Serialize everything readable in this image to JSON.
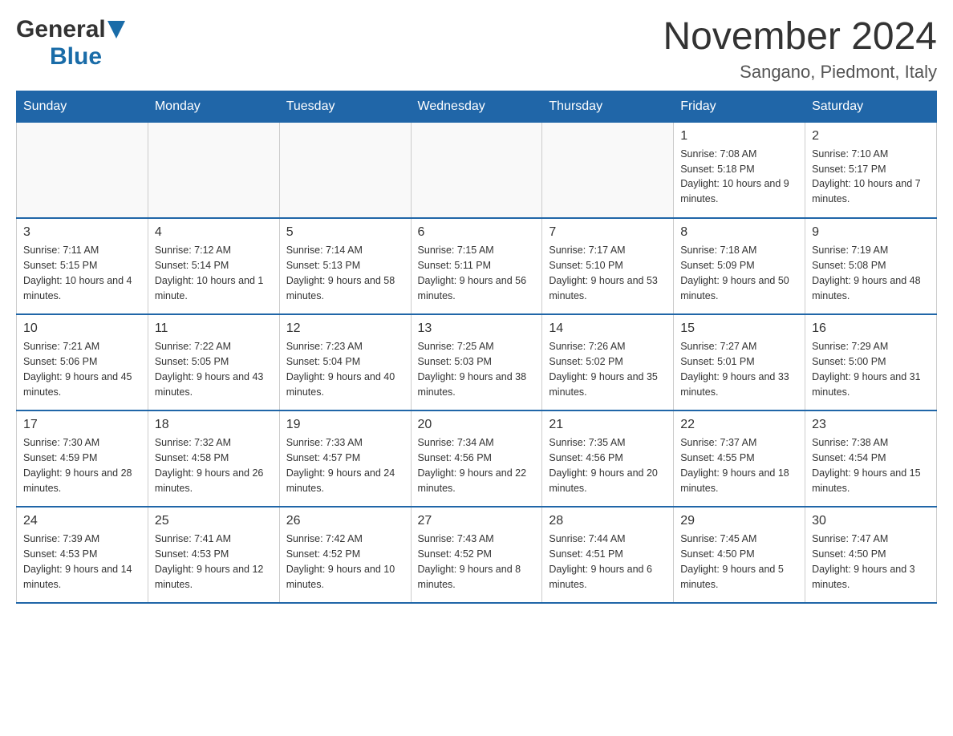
{
  "header": {
    "logo_general": "General",
    "logo_blue": "Blue",
    "title": "November 2024",
    "subtitle": "Sangano, Piedmont, Italy"
  },
  "days_of_week": [
    "Sunday",
    "Monday",
    "Tuesday",
    "Wednesday",
    "Thursday",
    "Friday",
    "Saturday"
  ],
  "weeks": [
    {
      "days": [
        {
          "num": "",
          "detail": ""
        },
        {
          "num": "",
          "detail": ""
        },
        {
          "num": "",
          "detail": ""
        },
        {
          "num": "",
          "detail": ""
        },
        {
          "num": "",
          "detail": ""
        },
        {
          "num": "1",
          "detail": "Sunrise: 7:08 AM\nSunset: 5:18 PM\nDaylight: 10 hours and 9 minutes."
        },
        {
          "num": "2",
          "detail": "Sunrise: 7:10 AM\nSunset: 5:17 PM\nDaylight: 10 hours and 7 minutes."
        }
      ]
    },
    {
      "days": [
        {
          "num": "3",
          "detail": "Sunrise: 7:11 AM\nSunset: 5:15 PM\nDaylight: 10 hours and 4 minutes."
        },
        {
          "num": "4",
          "detail": "Sunrise: 7:12 AM\nSunset: 5:14 PM\nDaylight: 10 hours and 1 minute."
        },
        {
          "num": "5",
          "detail": "Sunrise: 7:14 AM\nSunset: 5:13 PM\nDaylight: 9 hours and 58 minutes."
        },
        {
          "num": "6",
          "detail": "Sunrise: 7:15 AM\nSunset: 5:11 PM\nDaylight: 9 hours and 56 minutes."
        },
        {
          "num": "7",
          "detail": "Sunrise: 7:17 AM\nSunset: 5:10 PM\nDaylight: 9 hours and 53 minutes."
        },
        {
          "num": "8",
          "detail": "Sunrise: 7:18 AM\nSunset: 5:09 PM\nDaylight: 9 hours and 50 minutes."
        },
        {
          "num": "9",
          "detail": "Sunrise: 7:19 AM\nSunset: 5:08 PM\nDaylight: 9 hours and 48 minutes."
        }
      ]
    },
    {
      "days": [
        {
          "num": "10",
          "detail": "Sunrise: 7:21 AM\nSunset: 5:06 PM\nDaylight: 9 hours and 45 minutes."
        },
        {
          "num": "11",
          "detail": "Sunrise: 7:22 AM\nSunset: 5:05 PM\nDaylight: 9 hours and 43 minutes."
        },
        {
          "num": "12",
          "detail": "Sunrise: 7:23 AM\nSunset: 5:04 PM\nDaylight: 9 hours and 40 minutes."
        },
        {
          "num": "13",
          "detail": "Sunrise: 7:25 AM\nSunset: 5:03 PM\nDaylight: 9 hours and 38 minutes."
        },
        {
          "num": "14",
          "detail": "Sunrise: 7:26 AM\nSunset: 5:02 PM\nDaylight: 9 hours and 35 minutes."
        },
        {
          "num": "15",
          "detail": "Sunrise: 7:27 AM\nSunset: 5:01 PM\nDaylight: 9 hours and 33 minutes."
        },
        {
          "num": "16",
          "detail": "Sunrise: 7:29 AM\nSunset: 5:00 PM\nDaylight: 9 hours and 31 minutes."
        }
      ]
    },
    {
      "days": [
        {
          "num": "17",
          "detail": "Sunrise: 7:30 AM\nSunset: 4:59 PM\nDaylight: 9 hours and 28 minutes."
        },
        {
          "num": "18",
          "detail": "Sunrise: 7:32 AM\nSunset: 4:58 PM\nDaylight: 9 hours and 26 minutes."
        },
        {
          "num": "19",
          "detail": "Sunrise: 7:33 AM\nSunset: 4:57 PM\nDaylight: 9 hours and 24 minutes."
        },
        {
          "num": "20",
          "detail": "Sunrise: 7:34 AM\nSunset: 4:56 PM\nDaylight: 9 hours and 22 minutes."
        },
        {
          "num": "21",
          "detail": "Sunrise: 7:35 AM\nSunset: 4:56 PM\nDaylight: 9 hours and 20 minutes."
        },
        {
          "num": "22",
          "detail": "Sunrise: 7:37 AM\nSunset: 4:55 PM\nDaylight: 9 hours and 18 minutes."
        },
        {
          "num": "23",
          "detail": "Sunrise: 7:38 AM\nSunset: 4:54 PM\nDaylight: 9 hours and 15 minutes."
        }
      ]
    },
    {
      "days": [
        {
          "num": "24",
          "detail": "Sunrise: 7:39 AM\nSunset: 4:53 PM\nDaylight: 9 hours and 14 minutes."
        },
        {
          "num": "25",
          "detail": "Sunrise: 7:41 AM\nSunset: 4:53 PM\nDaylight: 9 hours and 12 minutes."
        },
        {
          "num": "26",
          "detail": "Sunrise: 7:42 AM\nSunset: 4:52 PM\nDaylight: 9 hours and 10 minutes."
        },
        {
          "num": "27",
          "detail": "Sunrise: 7:43 AM\nSunset: 4:52 PM\nDaylight: 9 hours and 8 minutes."
        },
        {
          "num": "28",
          "detail": "Sunrise: 7:44 AM\nSunset: 4:51 PM\nDaylight: 9 hours and 6 minutes."
        },
        {
          "num": "29",
          "detail": "Sunrise: 7:45 AM\nSunset: 4:50 PM\nDaylight: 9 hours and 5 minutes."
        },
        {
          "num": "30",
          "detail": "Sunrise: 7:47 AM\nSunset: 4:50 PM\nDaylight: 9 hours and 3 minutes."
        }
      ]
    }
  ]
}
